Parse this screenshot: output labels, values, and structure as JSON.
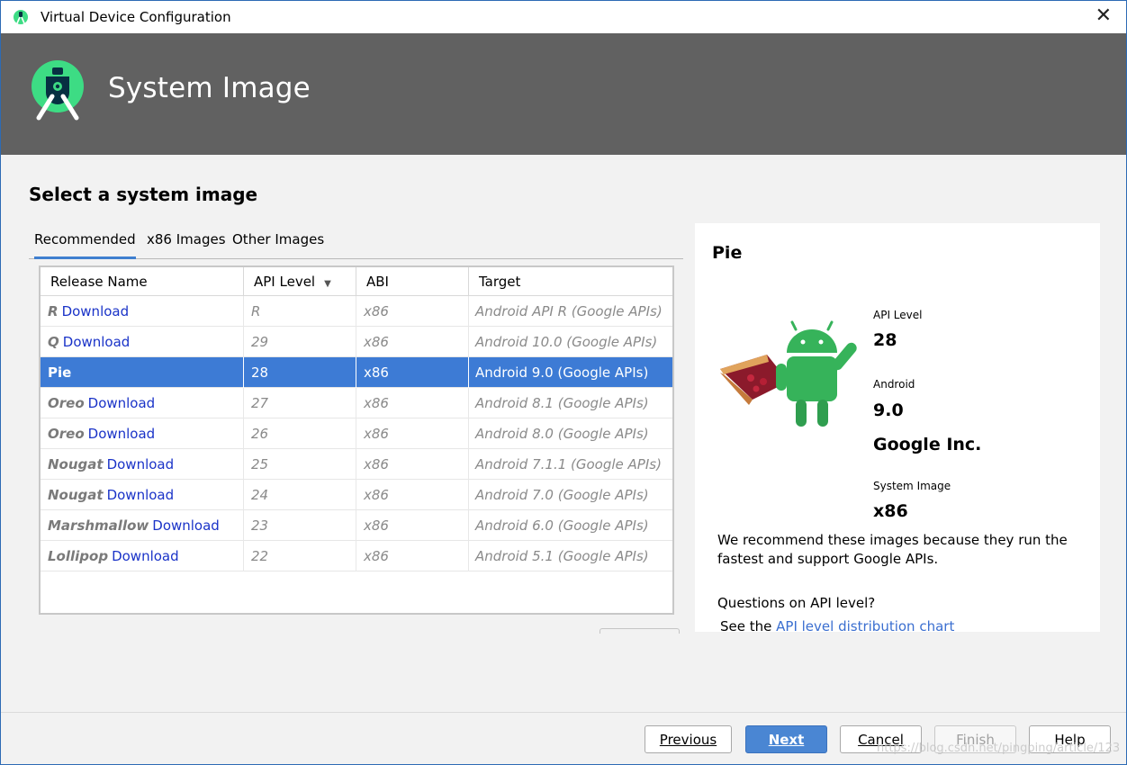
{
  "window": {
    "title": "Virtual Device Configuration",
    "close_glyph": "✕"
  },
  "banner": {
    "heading": "System Image"
  },
  "section_title": "Select a system image",
  "tabs": [
    {
      "label": "Recommended",
      "active": true
    },
    {
      "label": "x86 Images",
      "active": false
    },
    {
      "label": "Other Images",
      "active": false
    }
  ],
  "table": {
    "columns": [
      "Release Name",
      "API Level",
      "ABI",
      "Target"
    ],
    "sort_glyph": "▼",
    "rows": [
      {
        "name": "R",
        "action": "Download",
        "api": "R",
        "abi": "x86",
        "target": "Android API R (Google APIs)",
        "selected": false
      },
      {
        "name": "Q",
        "action": "Download",
        "api": "29",
        "abi": "x86",
        "target": "Android 10.0 (Google APIs)",
        "selected": false
      },
      {
        "name": "Pie",
        "action": "",
        "api": "28",
        "abi": "x86",
        "target": "Android 9.0 (Google APIs)",
        "selected": true
      },
      {
        "name": "Oreo",
        "action": "Download",
        "api": "27",
        "abi": "x86",
        "target": "Android 8.1 (Google APIs)",
        "selected": false
      },
      {
        "name": "Oreo",
        "action": "Download",
        "api": "26",
        "abi": "x86",
        "target": "Android 8.0 (Google APIs)",
        "selected": false
      },
      {
        "name": "Nougat",
        "action": "Download",
        "api": "25",
        "abi": "x86",
        "target": "Android 7.1.1 (Google APIs)",
        "selected": false
      },
      {
        "name": "Nougat",
        "action": "Download",
        "api": "24",
        "abi": "x86",
        "target": "Android 7.0 (Google APIs)",
        "selected": false
      },
      {
        "name": "Marshmallow",
        "action": "Download",
        "api": "23",
        "abi": "x86",
        "target": "Android 6.0 (Google APIs)",
        "selected": false
      },
      {
        "name": "Lollipop",
        "action": "Download",
        "api": "22",
        "abi": "x86",
        "target": "Android 5.1 (Google APIs)",
        "selected": false
      }
    ]
  },
  "panel": {
    "title": "Pie",
    "api_level_label": "API Level",
    "api_level_value": "28",
    "android_label": "Android",
    "android_value": "9.0",
    "vendor": "Google Inc.",
    "system_image_label": "System Image",
    "system_image_value": "x86",
    "recommend_text": "We recommend these images because they run the fastest and support Google APIs.",
    "question": "Questions on API level?",
    "see_the": "See the ",
    "chart_link": "API level distribution chart"
  },
  "buttons": {
    "previous": "Previous",
    "next": "Next",
    "cancel": "Cancel",
    "finish": "Finish",
    "help": "Help"
  },
  "watermark": "https://blog.csdn.net/pingping/article/123",
  "colors": {
    "banner": "#616161",
    "selection": "#3d7bd5",
    "link": "#1a33c8",
    "primary_button": "#4a86d3",
    "android_green": "#3ddc84"
  }
}
